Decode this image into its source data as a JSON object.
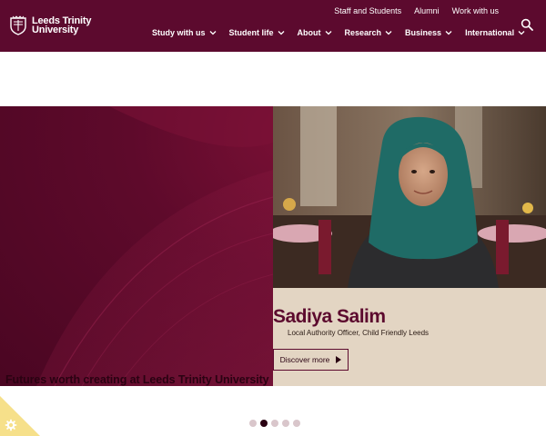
{
  "brand": {
    "logo_line1": "Leeds Trinity",
    "logo_line2": "University",
    "primary_color": "#5c0a2e",
    "accent_color": "#f6e08a"
  },
  "utility_nav": [
    {
      "label": "Staff and Students"
    },
    {
      "label": "Alumni"
    },
    {
      "label": "Work with us"
    }
  ],
  "main_nav": [
    {
      "label": "Study with us",
      "icon": "chevron-down-icon"
    },
    {
      "label": "Student life",
      "icon": "chevron-down-icon"
    },
    {
      "label": "About",
      "icon": "chevron-down-icon"
    },
    {
      "label": "Research",
      "icon": "chevron-down-icon"
    },
    {
      "label": "Business",
      "icon": "chevron-down-icon"
    },
    {
      "label": "International",
      "icon": "chevron-down-icon"
    }
  ],
  "search": {
    "icon": "search-icon"
  },
  "hero": {
    "tagline": "Futures worth creating at Leeds Trinity University",
    "person_name": "Sadiya Salim",
    "person_role": "Local Authority Officer, Child Friendly Leeds",
    "cta_label": "Discover more",
    "cta_icon": "play-icon"
  },
  "carousel": {
    "total_slides": 5,
    "active_slide": 2
  },
  "cookie": {
    "icon": "gear-icon"
  }
}
